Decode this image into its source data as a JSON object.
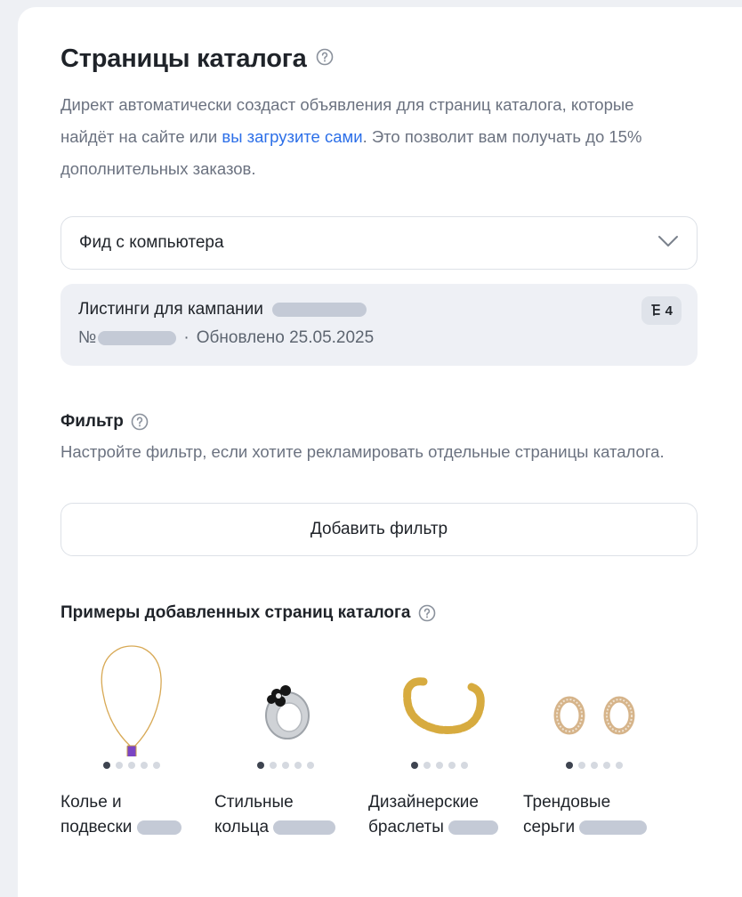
{
  "catalog": {
    "title": "Страницы каталога",
    "desc_before": "Директ автоматически создаст объявления для страниц каталога, которые найдёт на сайте или ",
    "desc_link": "вы загрузите сами",
    "desc_after": ". Это позволит вам получать до 15% дополнительных заказов."
  },
  "feed_select": {
    "value": "Фид с компьютера"
  },
  "feed": {
    "name_label": "Листинги для кампании",
    "number_prefix": "№",
    "separator": "·",
    "updated": "Обновлено 25.05.2025",
    "count": "4"
  },
  "filter": {
    "title": "Фильтр",
    "desc": "Настройте фильтр, если хотите рекламировать отдельные страницы каталога.",
    "add_button": "Добавить фильтр"
  },
  "examples": {
    "title": "Примеры добавленных страниц каталога",
    "items": [
      {
        "line1": "Колье и",
        "line2": "подвески",
        "icon": "necklace"
      },
      {
        "line1": "Стильные",
        "line2": "кольца",
        "icon": "ring"
      },
      {
        "line1": "Дизайнерские",
        "line2": "браслеты",
        "icon": "bracelet"
      },
      {
        "line1": "Трендовые",
        "line2": "серьги",
        "icon": "earrings"
      }
    ]
  },
  "colors": {
    "link": "#2c6fe8",
    "muted": "#6b7280",
    "card_bg": "#eef0f5"
  }
}
